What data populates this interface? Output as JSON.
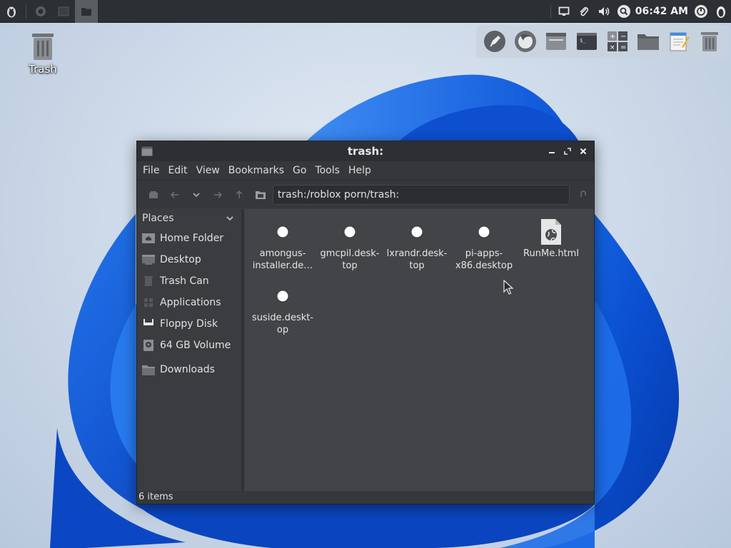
{
  "top_panel": {
    "clock": "06:42 AM"
  },
  "desktop": {
    "icons": [
      {
        "label": "Trash",
        "icon": "trash-icon"
      }
    ]
  },
  "dock": {
    "items": [
      "rocket-icon",
      "firefox-icon",
      "window-icon",
      "terminal-icon",
      "calculator-icon",
      "folder-icon",
      "notepad-icon",
      "trash-icon"
    ]
  },
  "window": {
    "title": "trash:",
    "menu": [
      "File",
      "Edit",
      "View",
      "Bookmarks",
      "Go",
      "Tools",
      "Help"
    ],
    "location": "trash:/roblox porn/trash:",
    "sidebar": {
      "header": "Places",
      "items": [
        {
          "label": "Home Folder",
          "icon": "home-folder-icon"
        },
        {
          "label": "Desktop",
          "icon": "desktop-icon"
        },
        {
          "label": "Trash Can",
          "icon": "trash-icon"
        },
        {
          "label": "Applications",
          "icon": "applications-icon"
        },
        {
          "label": "Floppy Disk",
          "icon": "floppy-icon"
        },
        {
          "label": "64 GB Volume",
          "icon": "drive-icon"
        },
        {
          "label": "Downloads",
          "icon": "folder-icon"
        }
      ]
    },
    "files": [
      {
        "name": "amongus-installer.de…",
        "line1": "amongus-",
        "line2": "installer.de…",
        "icon": "desktop-file-icon"
      },
      {
        "name": "gmcpil.desktop",
        "line1": "gmcpil.desk-",
        "line2": "top",
        "icon": "desktop-file-icon"
      },
      {
        "name": "lxrandr.desktop",
        "line1": "lxrandr.desk-",
        "line2": "top",
        "icon": "desktop-file-icon"
      },
      {
        "name": "pi-apps-x86.desktop",
        "line1": "pi-apps-",
        "line2": "x86.desktop",
        "icon": "desktop-file-icon"
      },
      {
        "name": "RunMe.html",
        "line1": "RunMe.html",
        "line2": "",
        "icon": "html-file-icon"
      },
      {
        "name": "suside.desktop",
        "line1": "suside.deskt-",
        "line2": "op",
        "icon": "desktop-file-icon"
      }
    ],
    "status": "6 items"
  }
}
